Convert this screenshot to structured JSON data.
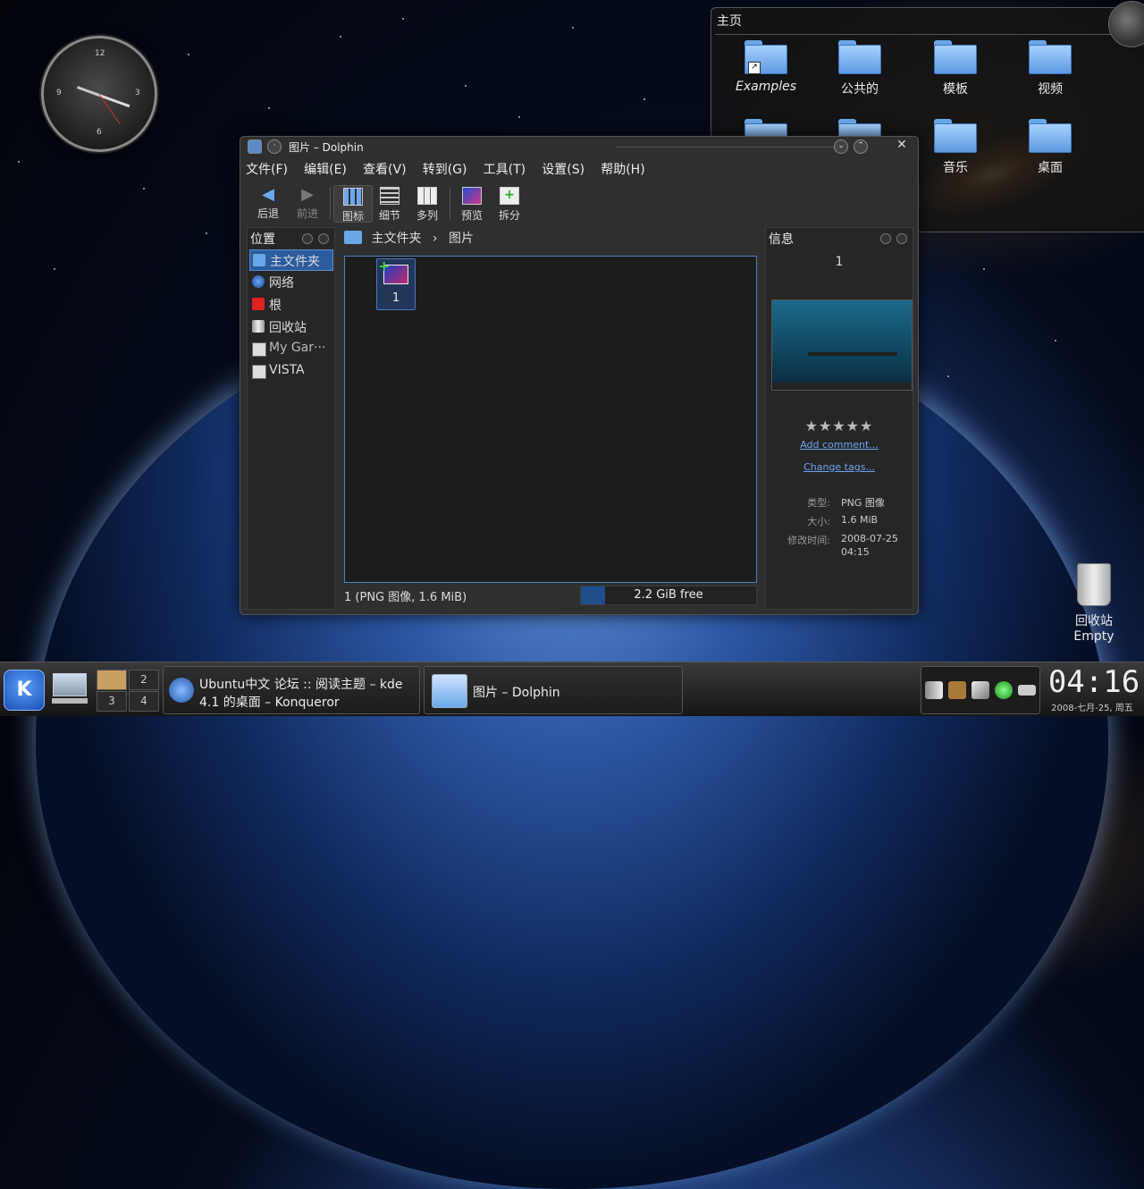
{
  "folderview": {
    "title": "主页",
    "items": [
      "Examples",
      "公共的",
      "模板",
      "视频",
      "音乐",
      "桌面"
    ]
  },
  "window": {
    "title": "图片 – Dolphin",
    "menu": [
      "文件(F)",
      "编辑(E)",
      "查看(V)",
      "转到(G)",
      "工具(T)",
      "设置(S)",
      "帮助(H)"
    ],
    "toolbar": {
      "back": "后退",
      "forward": "前进",
      "icons": "图标",
      "details": "细节",
      "columns": "多列",
      "preview": "预览",
      "split": "拆分"
    },
    "places": {
      "header": "位置",
      "items": [
        "主文件夹",
        "网络",
        "根",
        "回收站",
        "My Gar···",
        "VISTA"
      ]
    },
    "breadcrumb": {
      "home": "主文件夹",
      "sep": "›",
      "current": "图片"
    },
    "file": {
      "name": "1"
    },
    "status": "1 (PNG 图像, 1.6 MiB)",
    "free_space": {
      "label": "2.2 GiB free",
      "used_fraction": 0.14
    },
    "info": {
      "header": "信息",
      "name": "1",
      "rating": "★★★★★",
      "add_comment": "Add comment...",
      "change_tags": "Change tags...",
      "type_key": "类型:",
      "type_val": "PNG 图像",
      "size_key": "大小:",
      "size_val": "1.6 MiB",
      "modified_key": "修改时间:",
      "modified_date": "2008-07-25",
      "modified_time": "04:15"
    }
  },
  "desktop": {
    "trash_label": "回收站",
    "trash_status": "Empty"
  },
  "taskbar": {
    "pager": [
      "2",
      "3",
      "4"
    ],
    "task1_line1": "Ubuntu中文 论坛 :: 阅读主题 – kde",
    "task1_line2": "4.1 的桌面 – Konqueror",
    "task2": "图片 – Dolphin",
    "time": "04:16",
    "date": "2008-七月-25, 周五"
  },
  "clock": {
    "nums": [
      "12",
      "3",
      "6",
      "9"
    ]
  },
  "colors": {
    "accent": "#2c5c9c",
    "folder": "#6aa7e8"
  }
}
